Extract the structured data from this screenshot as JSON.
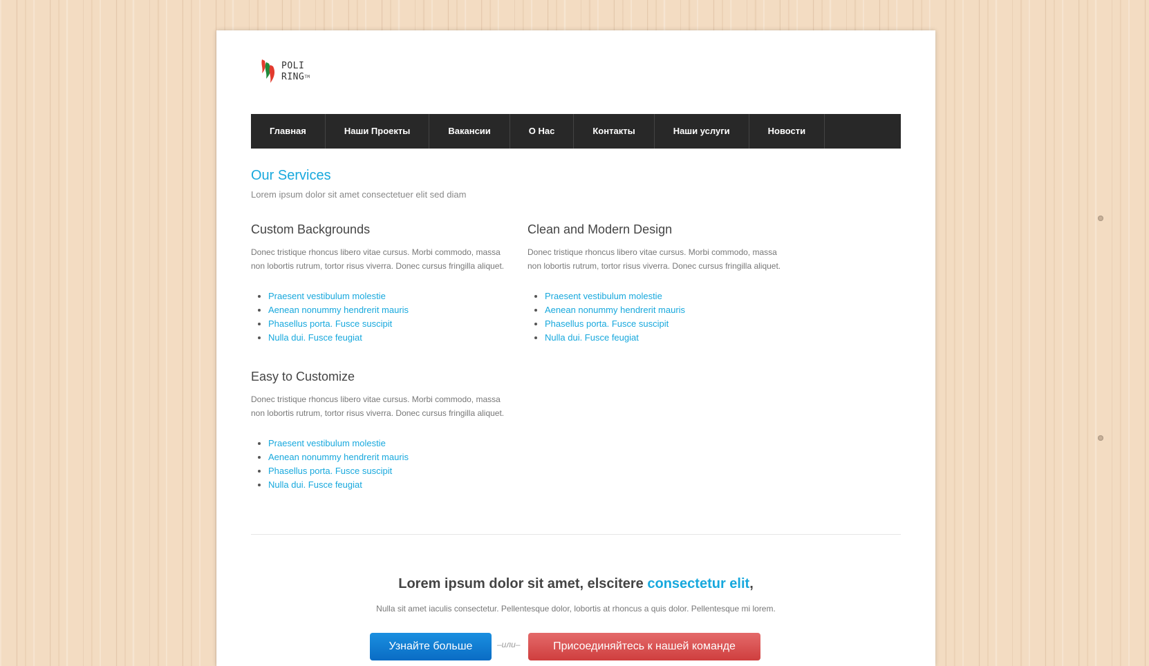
{
  "logo": {
    "line1": "POLI",
    "line2": "RING",
    "tm": "TM"
  },
  "nav": {
    "items": [
      "Главная",
      "Наши Проекты",
      "Вакансии",
      "О Нас",
      "Контакты",
      "Наши услуги",
      "Новости"
    ]
  },
  "services": {
    "title": "Our Services",
    "subtitle": "Lorem ipsum dolor sit amet consectetuer elit sed diam",
    "blocks": [
      {
        "heading": "Custom Backgrounds",
        "text": "Donec tristique rhoncus libero vitae cursus. Morbi commodo, massa non lobortis rutrum, tortor risus viverra. Donec cursus fringilla aliquet.",
        "links": [
          "Praesent vestibulum molestie",
          "Aenean nonummy hendrerit mauris",
          "Phasellus porta. Fusce suscipit",
          "Nulla dui. Fusce feugiat"
        ]
      },
      {
        "heading": "Clean and Modern Design",
        "text": "Donec tristique rhoncus libero vitae cursus. Morbi commodo, massa non lobortis rutrum, tortor risus viverra. Donec cursus fringilla aliquet.",
        "links": [
          "Praesent vestibulum molestie",
          "Aenean nonummy hendrerit mauris",
          "Phasellus porta. Fusce suscipit",
          "Nulla dui. Fusce feugiat"
        ]
      },
      {
        "heading": "Easy to Customize",
        "text": "Donec tristique rhoncus libero vitae cursus. Morbi commodo, massa non lobortis rutrum, tortor risus viverra. Donec cursus fringilla aliquet.",
        "links": [
          "Praesent vestibulum molestie",
          "Aenean nonummy hendrerit mauris",
          "Phasellus porta. Fusce suscipit",
          "Nulla dui. Fusce feugiat"
        ]
      }
    ]
  },
  "cta": {
    "title_main": "Lorem ipsum dolor sit amet, elscitere",
    "title_accent": "consectetur elit",
    "title_end": ",",
    "text": "Nulla sit amet iaculis consectetur. Pellentesque dolor, lobortis at rhoncus a quis dolor. Pellentesque mi lorem.",
    "btn_primary": "Узнайте больше",
    "or": "–или–",
    "btn_secondary": "Присоединяйтесь к нашей команде"
  },
  "colors": {
    "accent": "#17a8dd",
    "nav_bg": "#282828",
    "btn_blue": "#0a6cc4",
    "btn_red": "#cf3e3e"
  }
}
